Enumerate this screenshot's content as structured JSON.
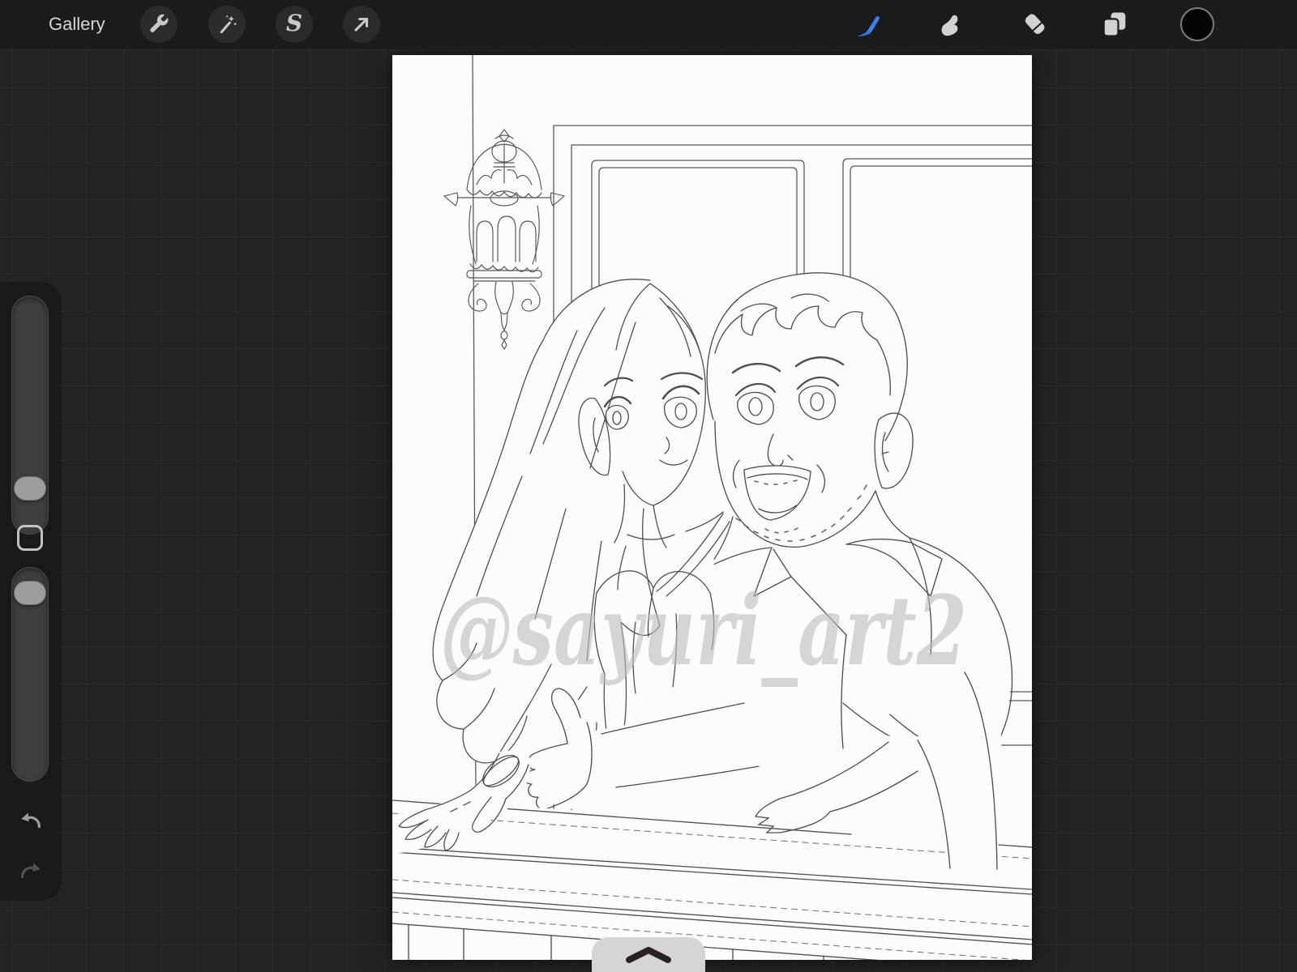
{
  "topbar": {
    "gallery_label": "Gallery",
    "left_tools": [
      {
        "id": "actions",
        "icon": "wrench-icon"
      },
      {
        "id": "adjustments",
        "icon": "magic-wand-icon"
      },
      {
        "id": "selection",
        "icon": "selection-s-icon"
      },
      {
        "id": "transform",
        "icon": "transform-arrow-icon"
      }
    ],
    "right_tools": [
      {
        "id": "paint",
        "icon": "brush-icon",
        "active": true
      },
      {
        "id": "smudge",
        "icon": "smudge-icon"
      },
      {
        "id": "erase",
        "icon": "eraser-icon"
      },
      {
        "id": "layers",
        "icon": "layers-icon"
      },
      {
        "id": "color",
        "icon": "color-swatch",
        "value": "#040404"
      }
    ]
  },
  "sidebar": {
    "sliders": [
      {
        "id": "brush-size"
      },
      {
        "id": "brush-opacity"
      }
    ],
    "modify_button": {
      "icon": "square-icon"
    },
    "undo": {
      "icon": "undo-arrow-icon"
    },
    "redo": {
      "icon": "redo-arrow-icon"
    }
  },
  "canvas": {
    "watermark": "@sayuri_art2",
    "artwork": "line-art of couple embracing at a railing by windows with ornate lantern",
    "background": "#fcfcfc"
  },
  "bottom_handle": {
    "icon": "chevron-up-icon"
  },
  "colors": {
    "topbar_bg": "#1b1b1d",
    "workspace_bg": "#232325",
    "accent_blue": "#3b82f7",
    "canvas_white": "#fcfcfc",
    "icon_gray": "#c9c9cb"
  }
}
